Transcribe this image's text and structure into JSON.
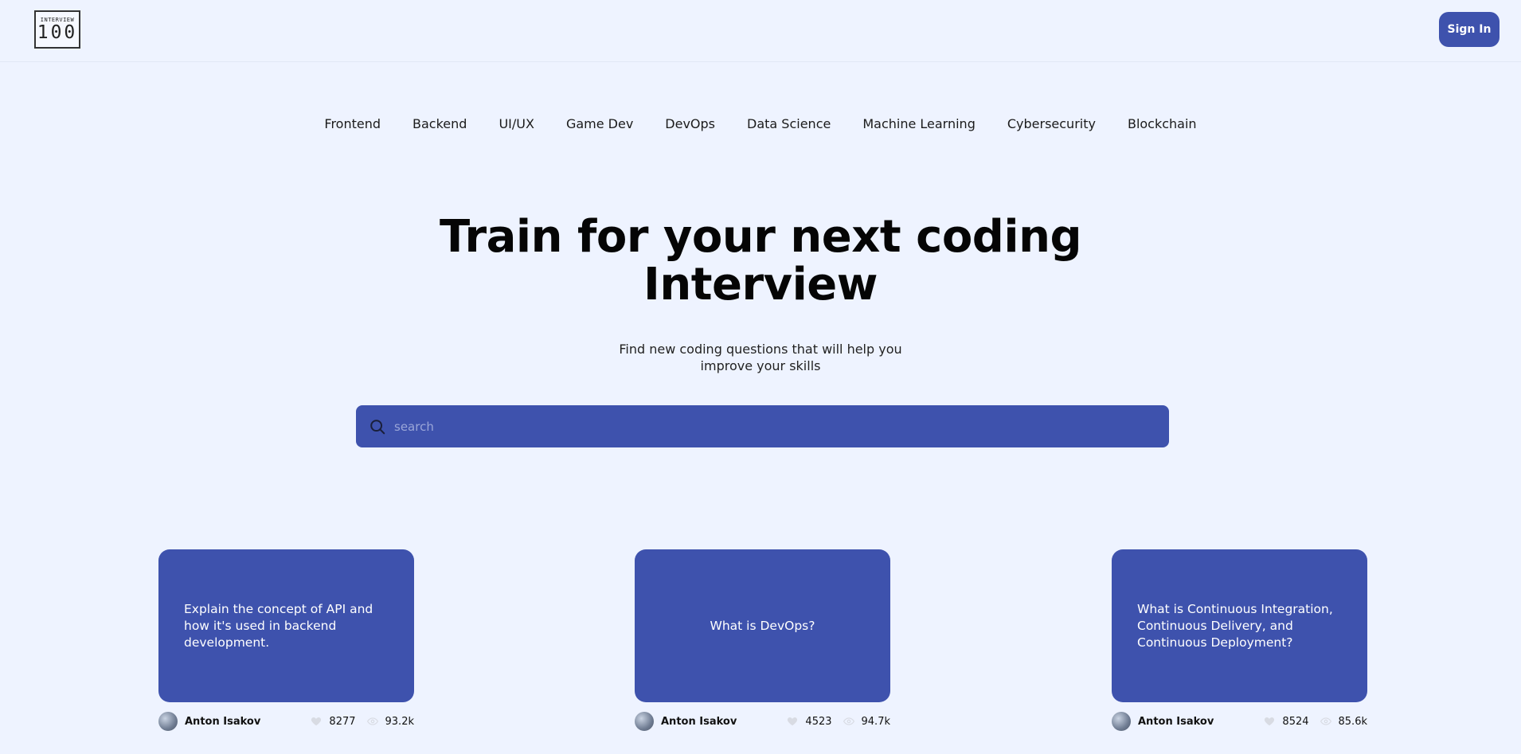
{
  "header": {
    "logo_top": "INTERVIEW",
    "logo_num": "100",
    "sign_in_label": "Sign In"
  },
  "nav": {
    "items": [
      "Frontend",
      "Backend",
      "UI/UX",
      "Game Dev",
      "DevOps",
      "Data Science",
      "Machine Learning",
      "Cybersecurity",
      "Blockchain"
    ]
  },
  "hero": {
    "title_line1": "Train for your next coding",
    "title_line2": "Interview",
    "subtitle_line1": "Find new coding questions that will help you",
    "subtitle_line2": "improve your skills"
  },
  "search": {
    "placeholder": "search"
  },
  "cards": [
    {
      "question": "Explain the concept of API and how it's used in backend development.",
      "author": "Anton Isakov",
      "likes": "8277",
      "views": "93.2k"
    },
    {
      "question": "What is DevOps?",
      "author": "Anton Isakov",
      "likes": "4523",
      "views": "94.7k"
    },
    {
      "question": "What is Continuous Integration, Continuous Delivery, and Continuous Deployment?",
      "author": "Anton Isakov",
      "likes": "8524",
      "views": "85.6k"
    }
  ],
  "icons": {
    "search": "search-icon",
    "like": "heart-icon",
    "views": "eye-icon"
  },
  "colors": {
    "background": "#eef3ff",
    "accent": "#3e52ad",
    "text": "#050505"
  }
}
